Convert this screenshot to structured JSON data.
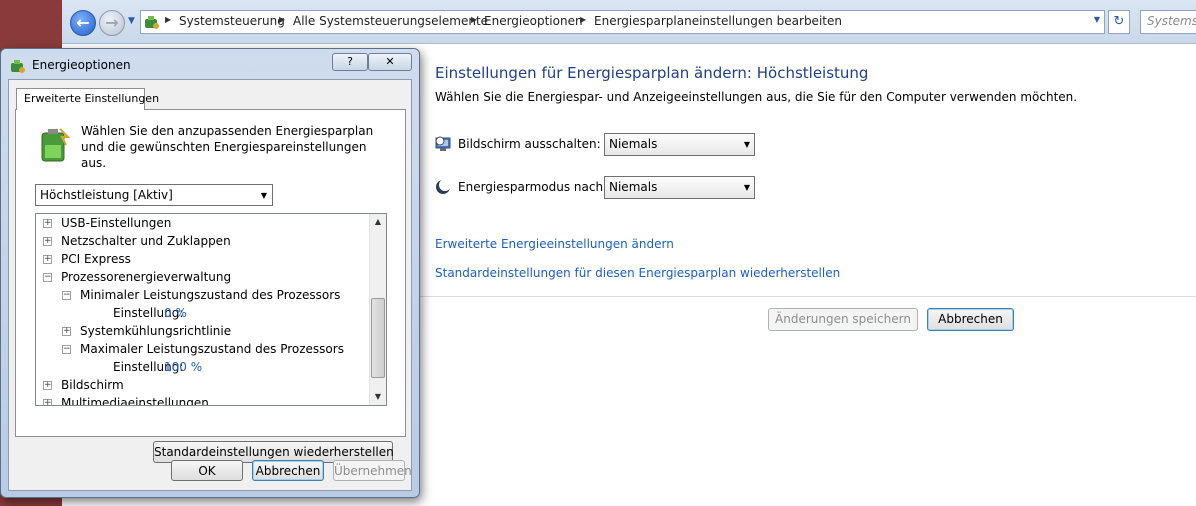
{
  "explorer": {
    "breadcrumbs": [
      "Systemsteuerung",
      "Alle Systemsteuerungselemente",
      "Energieoptionen",
      "Energiesparplaneinstellungen bearbeiten"
    ],
    "search_placeholder": "Systemste",
    "title": "Einstellungen für Energiesparplan ändern: Höchstleistung",
    "subtitle": "Wählen Sie die Energiespar- und Anzeigeeinstellungen aus, die Sie für den Computer verwenden möchten.",
    "settings": [
      {
        "label": "Bildschirm ausschalten:",
        "value": "Niemals",
        "icon": "monitor-clock-icon"
      },
      {
        "label": "Energiesparmodus nach:",
        "value": "Niemals",
        "icon": "moon-icon"
      }
    ],
    "links": {
      "advanced": "Erweiterte Energieeinstellungen ändern",
      "restore": "Standardeinstellungen für diesen Energiesparplan wiederherstellen"
    },
    "buttons": {
      "save": "Änderungen speichern",
      "cancel": "Abbrechen"
    }
  },
  "dialog": {
    "title": "Energieoptionen",
    "help": "?",
    "close": "✕",
    "tab": "Erweiterte Einstellungen",
    "description": "Wählen Sie den anzupassenden Energiesparplan und die gewünschten Energiespareinstellungen aus.",
    "plan": "Höchstleistung [Aktiv]",
    "tree": [
      {
        "label": "USB-Einstellungen",
        "expander": "+",
        "level": 0
      },
      {
        "label": "Netzschalter und Zuklappen",
        "expander": "+",
        "level": 0
      },
      {
        "label": "PCI Express",
        "expander": "+",
        "level": 0
      },
      {
        "label": "Prozessorenergieverwaltung",
        "expander": "−",
        "level": 0
      },
      {
        "label": "Minimaler Leistungszustand des Prozessors",
        "expander": "−",
        "level": 1
      },
      {
        "label": "Einstellung:",
        "value": "0 %",
        "expander": "",
        "level": 2
      },
      {
        "label": "Systemkühlungsrichtlinie",
        "expander": "+",
        "level": 1
      },
      {
        "label": "Maximaler Leistungszustand des Prozessors",
        "expander": "−",
        "level": 1
      },
      {
        "label": "Einstellung:",
        "value": "100 %",
        "expander": "",
        "level": 2
      },
      {
        "label": "Bildschirm",
        "expander": "+",
        "level": 0
      },
      {
        "label": "Multimediaeinstellungen",
        "expander": "+",
        "level": 0
      }
    ],
    "buttons": {
      "restore_defaults": "Standardeinstellungen wiederherstellen",
      "ok": "OK",
      "cancel": "Abbrechen",
      "apply": "Übernehmen"
    }
  },
  "colors": {
    "link": "#1a5ec6",
    "title": "#1e3f8c",
    "desktop": "#8a3a3a"
  }
}
